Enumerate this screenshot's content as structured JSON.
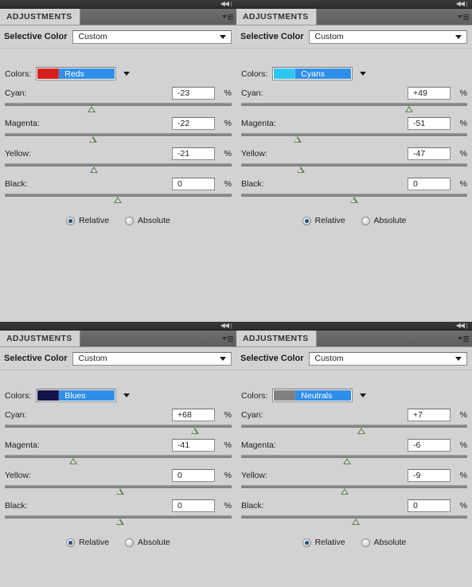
{
  "panels": [
    {
      "id": "panel-reds",
      "tab_label": "ADJUSTMENTS",
      "title": "Selective Color",
      "preset_label": "Custom",
      "colors_label": "Colors:",
      "color_name": "Reds",
      "swatch_color": "#d81f1f",
      "highlight_color": "#2f8fe8",
      "percent_symbol": "%",
      "sliders": [
        {
          "label": "Cyan:",
          "value": "-23",
          "pos_pct": 38.5
        },
        {
          "label": "Magenta:",
          "value": "-22",
          "pos_pct": 39.0
        },
        {
          "label": "Yellow:",
          "value": "-21",
          "pos_pct": 39.5
        },
        {
          "label": "Black:",
          "value": "0",
          "pos_pct": 50.0
        }
      ],
      "method": {
        "relative_label": "Relative",
        "absolute_label": "Absolute",
        "selected": "Relative"
      }
    },
    {
      "id": "panel-cyans",
      "tab_label": "ADJUSTMENTS",
      "title": "Selective Color",
      "preset_label": "Custom",
      "colors_label": "Colors:",
      "color_name": "Cyans",
      "swatch_color": "#2ec6f0",
      "highlight_color": "#2f8fe8",
      "percent_symbol": "%",
      "sliders": [
        {
          "label": "Cyan:",
          "value": "+49",
          "pos_pct": 74.5
        },
        {
          "label": "Magenta:",
          "value": "-51",
          "pos_pct": 25.0
        },
        {
          "label": "Yellow:",
          "value": "-47",
          "pos_pct": 26.5
        },
        {
          "label": "Black:",
          "value": "0",
          "pos_pct": 50.0
        }
      ],
      "method": {
        "relative_label": "Relative",
        "absolute_label": "Absolute",
        "selected": "Relative"
      }
    },
    {
      "id": "panel-blues",
      "tab_label": "ADJUSTMENTS",
      "title": "Selective Color",
      "preset_label": "Custom",
      "colors_label": "Colors:",
      "color_name": "Blues",
      "swatch_color": "#141449",
      "highlight_color": "#2f8fe8",
      "percent_symbol": "%",
      "sliders": [
        {
          "label": "Cyan:",
          "value": "+68",
          "pos_pct": 84.0
        },
        {
          "label": "Magenta:",
          "value": "-41",
          "pos_pct": 30.5
        },
        {
          "label": "Yellow:",
          "value": "0",
          "pos_pct": 51.0
        },
        {
          "label": "Black:",
          "value": "0",
          "pos_pct": 51.0
        }
      ],
      "method": {
        "relative_label": "Relative",
        "absolute_label": "Absolute",
        "selected": "Relative"
      }
    },
    {
      "id": "panel-neutrals",
      "tab_label": "ADJUSTMENTS",
      "title": "Selective Color",
      "preset_label": "Custom",
      "colors_label": "Colors:",
      "color_name": "Neutrals",
      "swatch_color": "#808080",
      "highlight_color": "#2f8fe8",
      "percent_symbol": "%",
      "sliders": [
        {
          "label": "Cyan:",
          "value": "+7",
          "pos_pct": 53.5
        },
        {
          "label": "Magenta:",
          "value": "-6",
          "pos_pct": 47.0
        },
        {
          "label": "Yellow:",
          "value": "-9",
          "pos_pct": 46.0
        },
        {
          "label": "Black:",
          "value": "0",
          "pos_pct": 51.0
        }
      ],
      "method": {
        "relative_label": "Relative",
        "absolute_label": "Absolute",
        "selected": "Relative"
      }
    }
  ]
}
